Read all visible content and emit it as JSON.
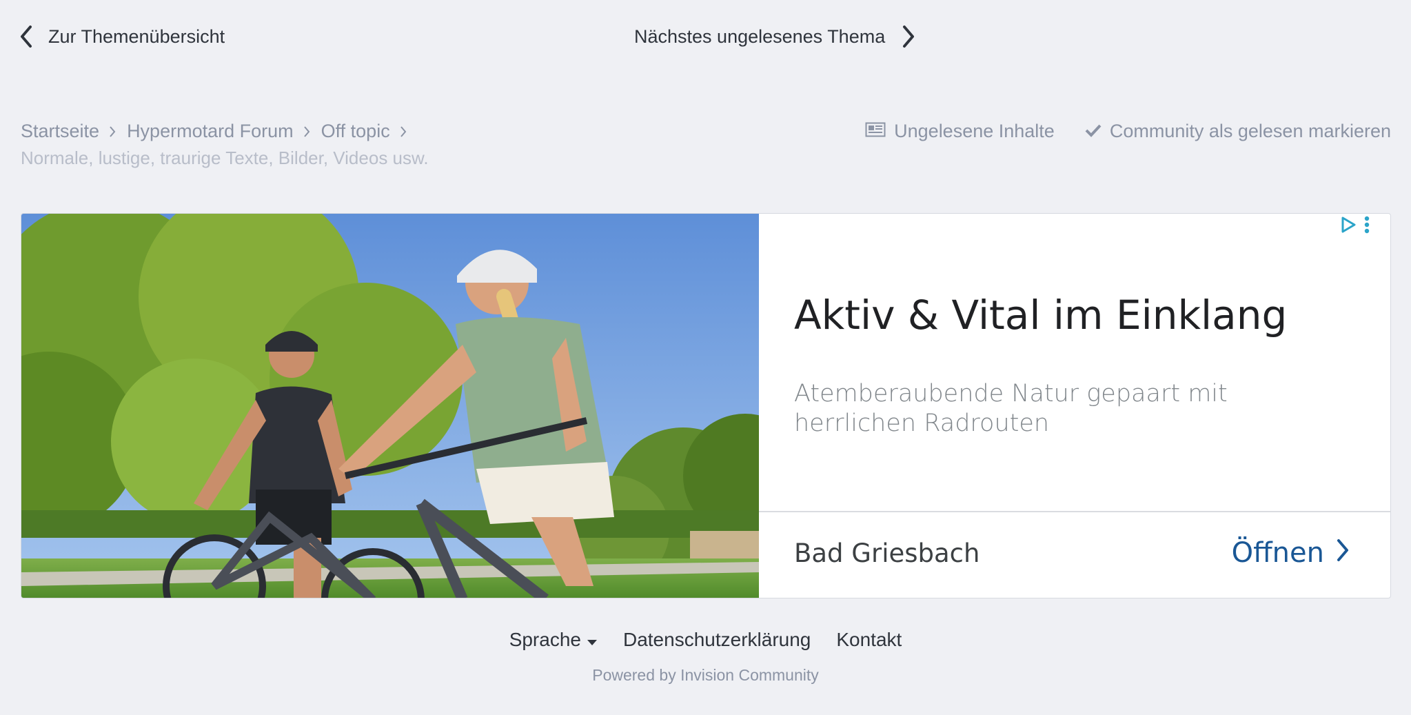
{
  "topnav": {
    "prev_label": "Zur Themenübersicht",
    "next_label": "Nächstes ungelesenes Thema"
  },
  "breadcrumb": {
    "items": [
      "Startseite",
      "Hypermotard Forum",
      "Off topic"
    ],
    "subtitle": "Normale, lustige, traurige Texte, Bilder, Videos usw."
  },
  "actions": {
    "unread_label": "Ungelesene Inhalte",
    "mark_read_label": "Community als gelesen markieren"
  },
  "ad": {
    "headline": "Aktiv & Vital im Einklang",
    "description": "Atemberaubende Natur gepaart mit herrlichen Radrouten",
    "advertiser": "Bad Griesbach",
    "cta_label": "Öffnen",
    "accent_color": "#1a5795",
    "choices_color": "#2ba4c9"
  },
  "footer": {
    "language_label": "Sprache",
    "privacy_label": "Datenschutzerklärung",
    "contact_label": "Kontakt",
    "powered_by": "Powered by Invision Community"
  },
  "colors": {
    "background": "#eff0f4",
    "muted_text": "#8b93a4"
  }
}
